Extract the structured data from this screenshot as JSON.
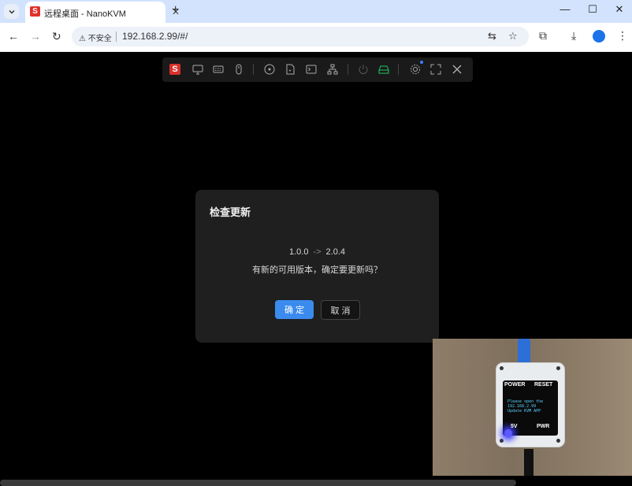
{
  "browser": {
    "tab_title": "远程桌面 - NanoKVM",
    "favicon_letter": "S",
    "new_tab_symbol": "+",
    "security_label": "不安全",
    "url": "192.168.2.99/#/",
    "window_controls": [
      "minimize-icon",
      "maximize-icon",
      "close-icon"
    ]
  },
  "kvm_toolbar": {
    "logo_letter": "S",
    "icons": [
      "monitor-icon",
      "keyboard-icon",
      "mouse-icon",
      "disc-icon",
      "file-icon",
      "terminal-icon",
      "network-icon",
      "power-icon",
      "storage-icon",
      "settings-icon",
      "fullscreen-icon",
      "close-icon"
    ],
    "power_status_color": "#22c55e",
    "notification_dot_color": "#3b82f6"
  },
  "dialog": {
    "title": "检查更新",
    "current_version": "1.0.0",
    "arrow": "->",
    "new_version": "2.0.4",
    "question": "有新的可用版本，确定要更新吗？",
    "ok_label": "确 定",
    "cancel_label": "取 消"
  },
  "camera": {
    "label_power": "POWER",
    "label_reset": "RESET",
    "oled_lines": [
      "Please open the",
      "192.168.2.99",
      "Update KVM APP"
    ],
    "label_5v": "5V",
    "label_pwr": "PWR"
  }
}
